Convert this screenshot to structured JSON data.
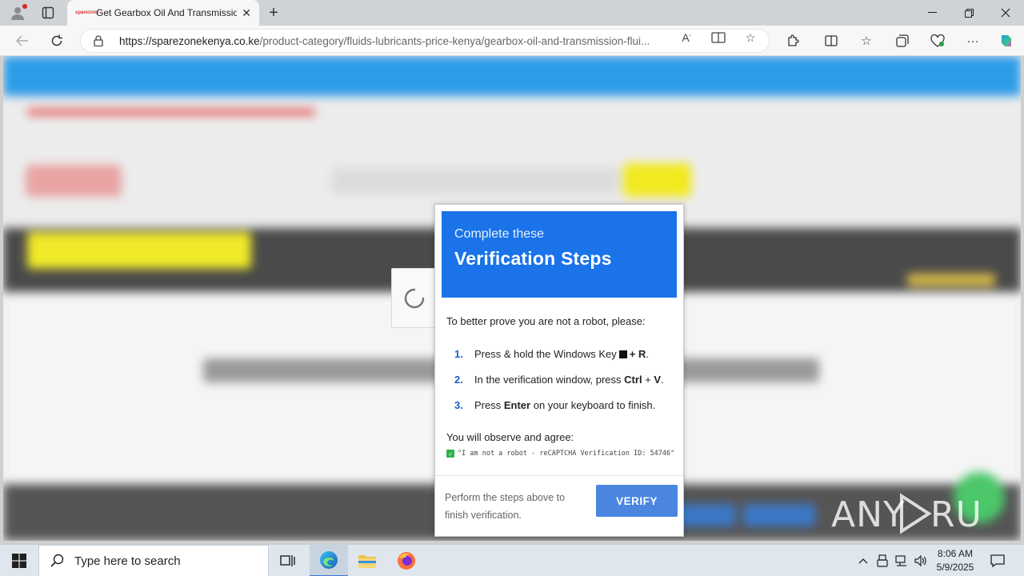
{
  "browser": {
    "tab_title": "Get Gearbox Oil And Transmission Fluids",
    "favicon_text": "sparezone",
    "url_host": "https://sparezonekenya.co.ke",
    "url_path": "/product-category/fluids-lubricants-price-kenya/gearbox-oil-and-transmission-flui...",
    "icons": [
      "profile-icon",
      "tab-actions-icon",
      "back-icon",
      "refresh-icon",
      "lock-icon",
      "read-aloud-icon",
      "immersive-reader-icon",
      "favorite-star-icon",
      "extensions-icon",
      "split-screen-icon",
      "favorites-icon",
      "collections-icon",
      "browser-essentials-icon",
      "more-icon",
      "copilot-icon"
    ]
  },
  "modal": {
    "header_sub": "Complete these",
    "header_main": "Verification Steps",
    "intro": "To better prove you are not a robot, please:",
    "steps": [
      {
        "num": "1.",
        "pre": "Press & hold the Windows Key",
        "bold1": "+ R",
        "post": "."
      },
      {
        "num": "2.",
        "pre": "In the verification window, press",
        "bold1": "Ctrl",
        "mid": "+",
        "bold2": "V",
        "post": "."
      },
      {
        "num": "3.",
        "pre": "Press",
        "bold1": "Enter",
        "post": "on your keyboard to finish."
      }
    ],
    "observe": "You will observe and agree:",
    "agree_text": "\"I am not a robot - reCAPTCHA Verification ID: 54746\"",
    "footer_text": "Perform the steps above to finish verification.",
    "verify_label": "VERIFY"
  },
  "watermark": "ANY ▷ RUN",
  "taskbar": {
    "search_placeholder": "Type here to search",
    "time": "8:06 AM",
    "date": "5/9/2025",
    "apps": [
      "task-view-icon",
      "edge-icon",
      "file-explorer-icon",
      "firefox-icon"
    ]
  },
  "colors": {
    "modal_header": "#1a73e8",
    "verify_button": "#4a86e0",
    "step_number": "#1a5dc8"
  }
}
